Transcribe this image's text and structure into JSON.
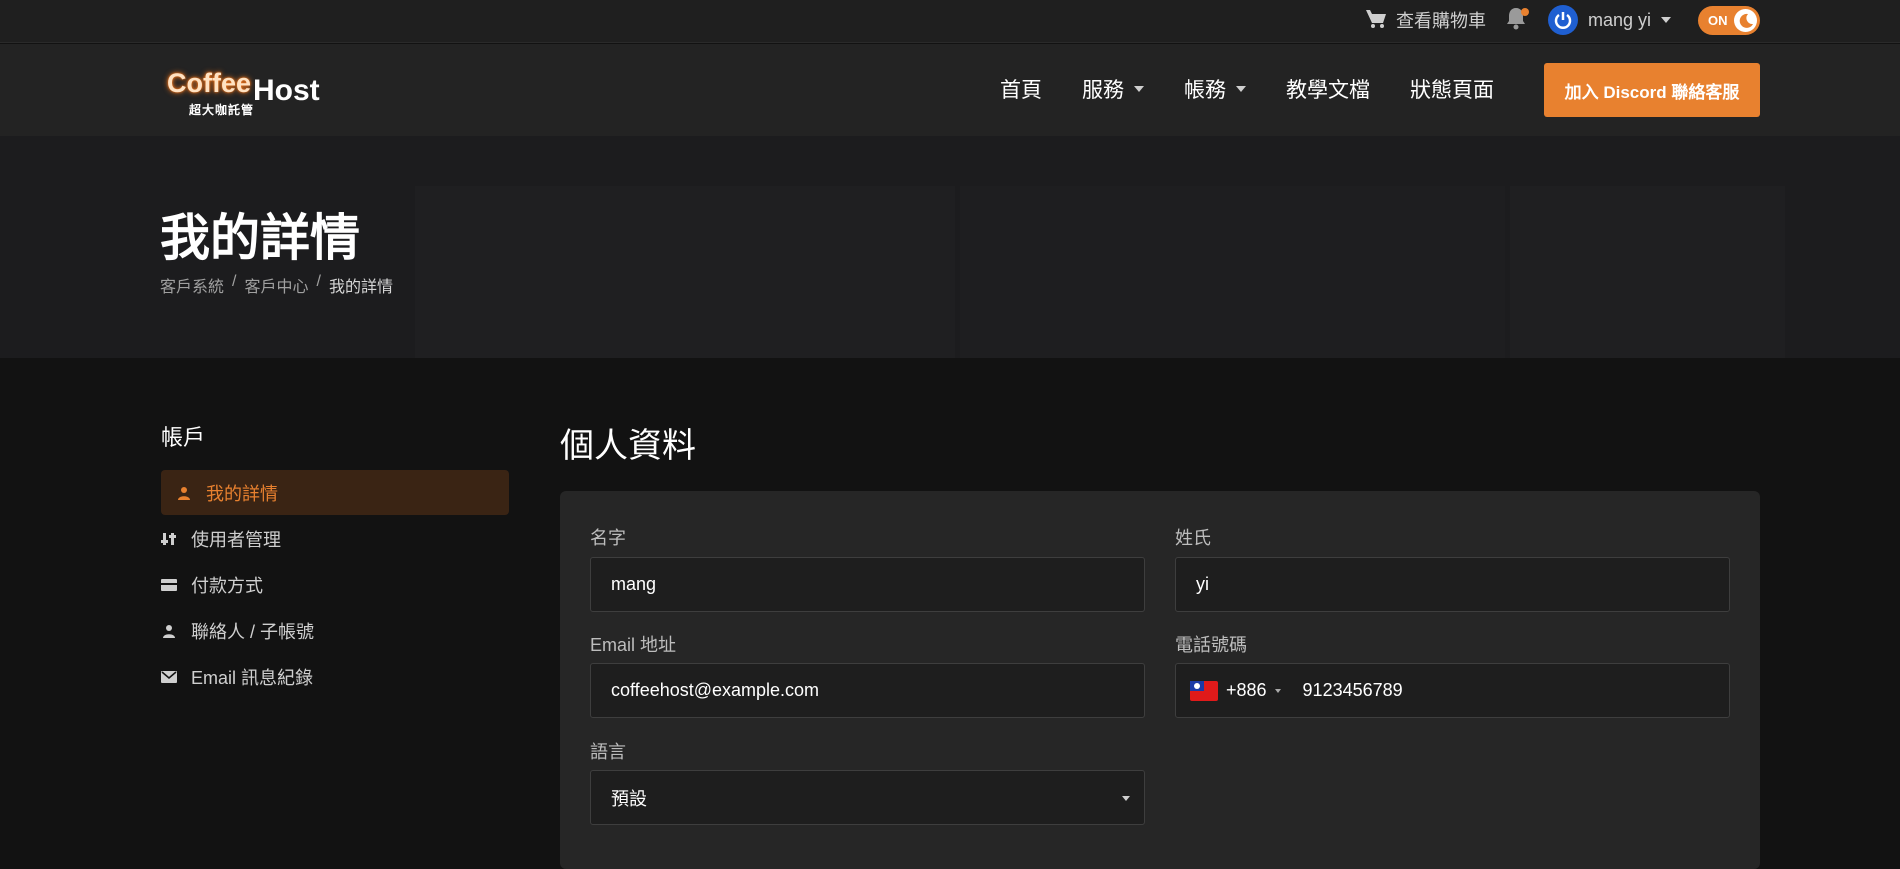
{
  "topbar": {
    "cart_label": "查看購物車",
    "user_name": "mang yi",
    "theme_toggle_label": "ON"
  },
  "navbar": {
    "logo_primary": "Coffee",
    "logo_secondary": "Host",
    "logo_sub": "超大咖託管",
    "links": [
      "首頁",
      "服務",
      "帳務",
      "教學文檔",
      "狀態頁面"
    ],
    "discord_button": "加入 Discord 聯絡客服"
  },
  "hero": {
    "title": "我的詳情",
    "breadcrumb": [
      "客戶系統",
      "客戶中心",
      "我的詳情"
    ]
  },
  "sidebar": {
    "title": "帳戶",
    "items": [
      {
        "label": "我的詳情",
        "icon": "user-icon"
      },
      {
        "label": "使用者管理",
        "icon": "users-manage-icon"
      },
      {
        "label": "付款方式",
        "icon": "credit-card-icon"
      },
      {
        "label": "聯絡人 / 子帳號",
        "icon": "contact-icon"
      },
      {
        "label": "Email 訊息紀錄",
        "icon": "envelope-icon"
      }
    ]
  },
  "profile": {
    "title": "個人資料",
    "first_name_label": "名字",
    "first_name_value": "mang",
    "last_name_label": "姓氏",
    "last_name_value": "yi",
    "email_label": "Email 地址",
    "email_value": "coffeehost@example.com",
    "phone_label": "電話號碼",
    "phone_code": "+886",
    "phone_value": "9123456789",
    "language_label": "語言",
    "language_value": "預設"
  },
  "colors": {
    "accent": "#e8812f",
    "background": "#121212",
    "card": "#262626"
  }
}
